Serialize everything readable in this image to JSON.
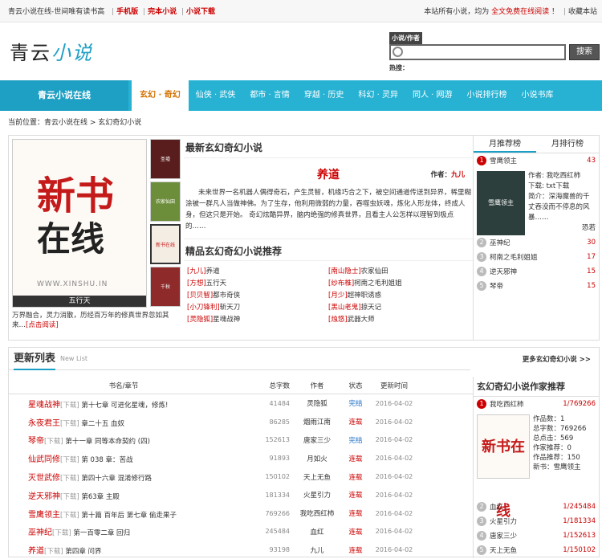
{
  "topbar": {
    "left": "青云小说在线-世间唯有读书高",
    "mobile": "手机版",
    "complete": "完本小说",
    "download": "小说下载",
    "right": "本站所有小说，均为",
    "right_red": "全文免费在线阅读",
    "right_end": "！",
    "fav": "收藏本站"
  },
  "logo": {
    "a": "青云",
    "b": "小说"
  },
  "search": {
    "tab": "小说/作者",
    "button": "搜索",
    "hot": "热搜："
  },
  "nav": {
    "brand": "青云小说在线",
    "items": [
      "玄幻 · 奇幻",
      "仙侠 · 武侠",
      "都市 · 言情",
      "穿越 · 历史",
      "科幻 · 灵异",
      "同人 · 网游",
      "小说排行榜",
      "小说书库"
    ]
  },
  "crumb": "当前位置：青云小说在线 > 玄幻奇幻小说",
  "cover": {
    "t1": "新书",
    "t2": "在线",
    "t3": "WWW.XINSHU.IN",
    "cap": "五行天",
    "desc": "万界融合，灵力消散，历经百万年的修真世界忽如其来…",
    "link": "[点击阅读]"
  },
  "thumbs": [
    "圣墟",
    "农家仙田",
    "新书在线",
    "千秋"
  ],
  "latest": {
    "heading": "最新玄幻奇幻小说",
    "title": "养道",
    "author_label": "作者：",
    "author": "九儿",
    "desc": "未来世界一名机器人偶得奇石，产生灵智，机缘巧合之下，被空间通道传送到异界，稀里糊涂被一群凡人当做神佛。为了生存，他利用微弱的力量，吞噬虫妖魂，炼化人形龙体，终成人身，但这只是开始。 奇幻炫酷异界，脑内绝强的修真世界，且看主人公怎样以理智到极点的……"
  },
  "rec": {
    "heading": "精品玄幻奇幻小说推荐",
    "items": [
      [
        "[九儿]",
        "养道"
      ],
      [
        "[南山隐士]",
        "农家仙田"
      ],
      [
        "[方想]",
        "五行天"
      ],
      [
        "[纱布椎]",
        "柯南之毛利姐姐"
      ],
      [
        "[贝贝智]",
        "都市奇侠"
      ],
      [
        "[月少]",
        "超神职诱惑"
      ],
      [
        "[小刀锋利]",
        "斩天刀"
      ],
      [
        "[黑山老鬼]",
        "掠天记"
      ],
      [
        "[灵隐狐]",
        "星魂战神"
      ],
      [
        "[烛悠]",
        "武器大师"
      ]
    ]
  },
  "rank": {
    "tab1": "月推荐榜",
    "tab2": "月排行榜",
    "top": {
      "n": "1",
      "name": "雪鹰领主",
      "val": "43"
    },
    "feat": {
      "img": "雪鹰领主",
      "l1": "作者: 我吃西红柿",
      "l2": "下载: txt下载",
      "l3": "简介：深海魔兽的千丈吞没而不停息的风暴……",
      "l4": "恐若"
    },
    "rows": [
      {
        "n": "2",
        "name": "巫神纪",
        "val": "30"
      },
      {
        "n": "3",
        "name": "柯南之毛利姐姐",
        "val": "17"
      },
      {
        "n": "4",
        "name": "逆天邪神",
        "val": "15"
      },
      {
        "n": "5",
        "name": "琴帝",
        "val": "15"
      }
    ]
  },
  "update": {
    "title": "更新列表",
    "en": "New List",
    "more": "更多玄幻奇幻小说 >>",
    "headers": [
      "书名/章节",
      "总字数",
      "作者",
      "状态",
      "更新时间"
    ],
    "rows": [
      {
        "name": "星魂战神",
        "dl": "[下载]",
        "ch": "第十七章 可进化星魂，修炼!",
        "words": "41484",
        "author": "灵隐狐",
        "status": "完结",
        "date": "2016-04-02"
      },
      {
        "name": "永夜君王",
        "dl": "[下载]",
        "ch": "章二十五 血奴",
        "words": "86285",
        "author": "烟雨江南",
        "status": "连载",
        "date": "2016-04-02"
      },
      {
        "name": "琴帝",
        "dl": "[下载]",
        "ch": "第十一章 同等本命契约 (四)",
        "words": "152613",
        "author": "唐家三少",
        "status": "完结",
        "date": "2016-04-02"
      },
      {
        "name": "仙武同修",
        "dl": "[下载]",
        "ch": "第 038 章：苦战",
        "words": "91893",
        "author": "月如火",
        "status": "连载",
        "date": "2016-04-02"
      },
      {
        "name": "灭世武修",
        "dl": "[下载]",
        "ch": "第四十六章 混淆修行路",
        "words": "150102",
        "author": "天上无鱼",
        "status": "连载",
        "date": "2016-04-02"
      },
      {
        "name": "逆天邪神",
        "dl": "[下载]",
        "ch": "第63章 主殿",
        "words": "181334",
        "author": "火星引力",
        "status": "连载",
        "date": "2016-04-02"
      },
      {
        "name": "雪鹰领主",
        "dl": "[下载]",
        "ch": "第十篇 百年后 第七章 偷走果子",
        "words": "769266",
        "author": "我吃西红柿",
        "status": "连载",
        "date": "2016-04-02"
      },
      {
        "name": "巫神纪",
        "dl": "[下载]",
        "ch": "第一百零二章 回归",
        "words": "245484",
        "author": "血红",
        "status": "连载",
        "date": "2016-04-02"
      },
      {
        "name": "养道",
        "dl": "[下载]",
        "ch": "第四章 问界",
        "words": "93198",
        "author": "九儿",
        "status": "连载",
        "date": "2016-04-02"
      }
    ]
  },
  "authors": {
    "heading": "玄幻奇幻小说作家推荐",
    "top": {
      "n": "1",
      "name": "我吃西红柿",
      "val": "1/769266"
    },
    "img": "新书在线",
    "info": [
      "作品数：1",
      "总字数：769266",
      "总点击：569",
      "作家推荐：0",
      "作品推荐：150",
      "新书：雪鹰领主"
    ],
    "rows": [
      {
        "n": "2",
        "name": "血红",
        "val": "1/245484"
      },
      {
        "n": "3",
        "name": "火星引力",
        "val": "1/181334"
      },
      {
        "n": "4",
        "name": "唐家三少",
        "val": "1/152613"
      },
      {
        "n": "5",
        "name": "天上无鱼",
        "val": "1/150102"
      }
    ]
  }
}
